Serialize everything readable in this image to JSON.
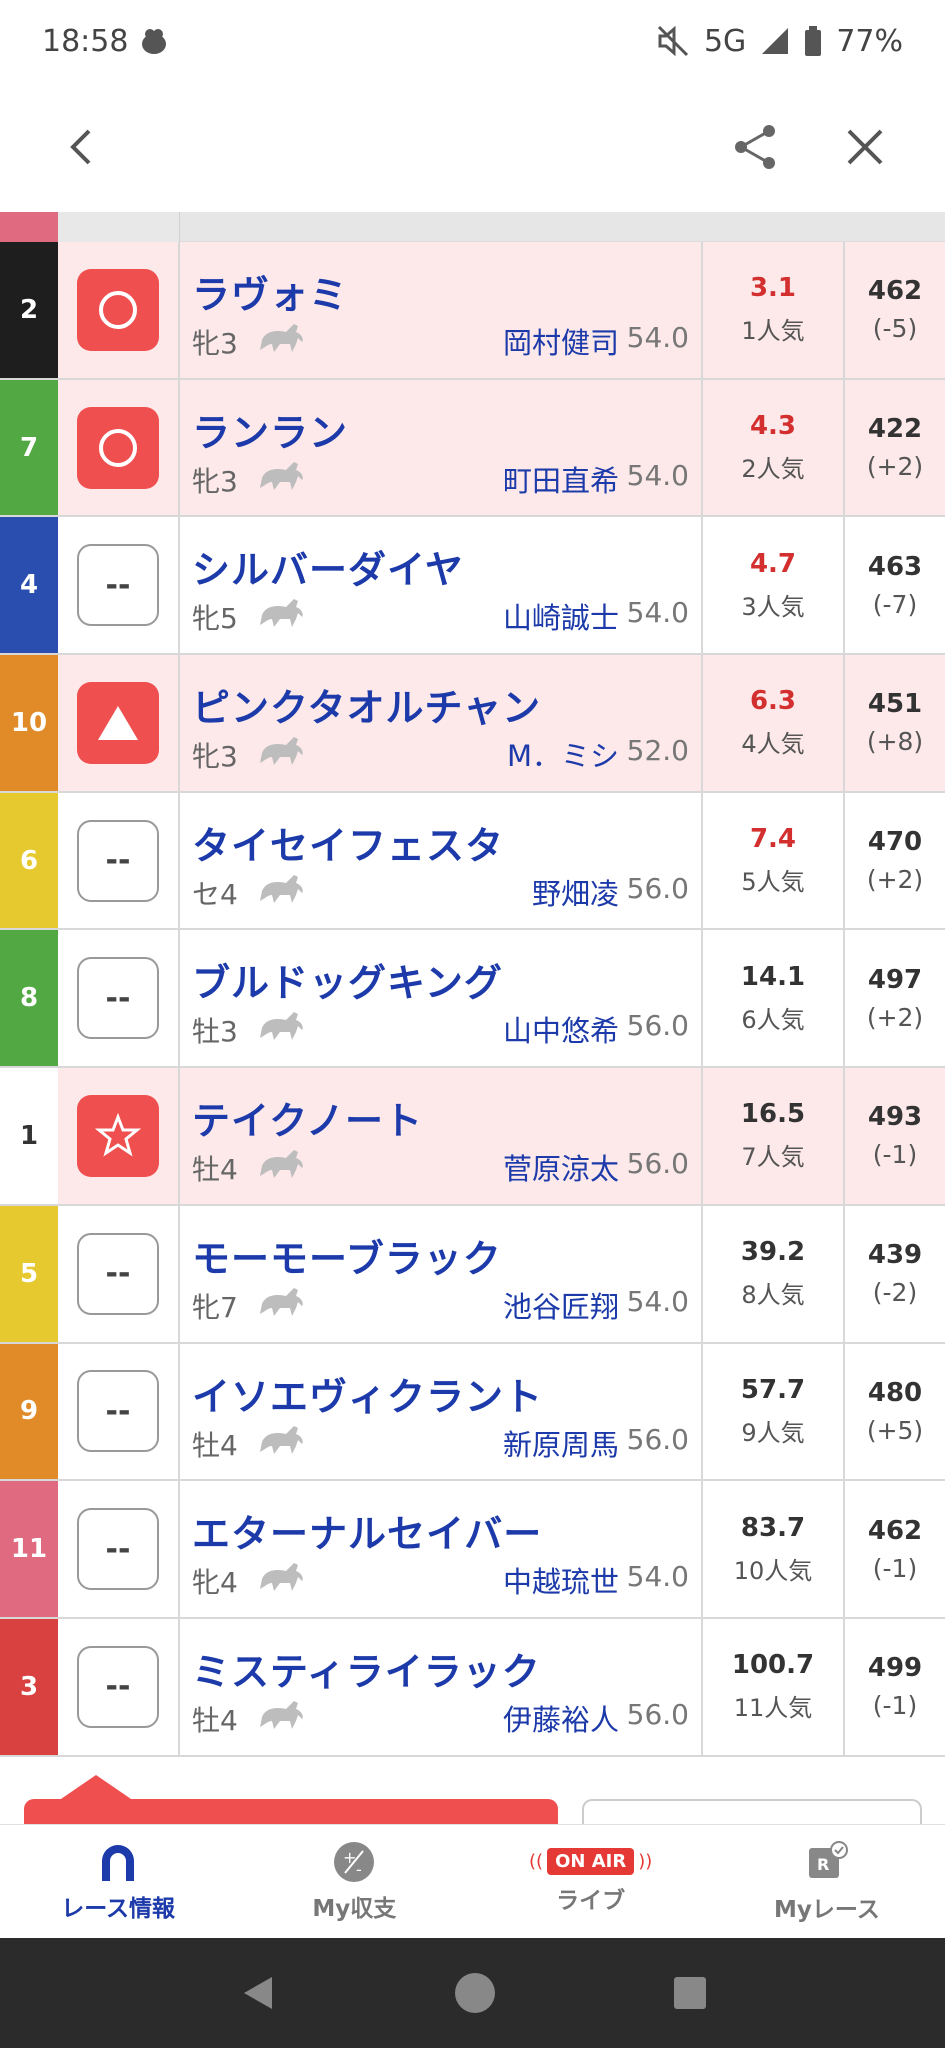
{
  "status_bar": {
    "time": "18:58",
    "network": "5G",
    "battery": "77%"
  },
  "colors": {
    "accent_red": "#ef4f4f",
    "name_blue": "#1c3aa9",
    "pink_row": "#fde9ea",
    "odds_red": "#d32f2f"
  },
  "rows": [
    {
      "waku": "2",
      "waku_color": "#1e1e1e",
      "waku_text": "#ffffff",
      "pink": true,
      "mark": "circle-icon",
      "name": "ラヴォミ",
      "sex_age": "牝3",
      "jockey": "岡村健司",
      "kinryo": "54.0",
      "odds": "3.1",
      "ninki": "1人気",
      "odds_hot": true,
      "weight": "462",
      "diff": "(-5)"
    },
    {
      "waku": "7",
      "waku_color": "#52a943",
      "waku_text": "#ffffff",
      "pink": true,
      "mark": "circle-icon",
      "name": "ランラン",
      "sex_age": "牝3",
      "jockey": "町田直希",
      "kinryo": "54.0",
      "odds": "4.3",
      "ninki": "2人気",
      "odds_hot": true,
      "weight": "422",
      "diff": "(+2)"
    },
    {
      "waku": "4",
      "waku_color": "#2a4eb0",
      "waku_text": "#ffffff",
      "pink": false,
      "mark": "--",
      "name": "シルバーダイヤ",
      "sex_age": "牝5",
      "jockey": "山崎誠士",
      "kinryo": "54.0",
      "odds": "4.7",
      "ninki": "3人気",
      "odds_hot": true,
      "weight": "463",
      "diff": "(-7)"
    },
    {
      "waku": "10",
      "waku_color": "#e08a28",
      "waku_text": "#ffffff",
      "pink": true,
      "mark": "triangle-icon",
      "name": "ピンクタオルチャン",
      "sex_age": "牝3",
      "jockey": "М．ミシ",
      "kinryo": "52.0",
      "odds": "6.3",
      "ninki": "4人気",
      "odds_hot": true,
      "weight": "451",
      "diff": "(+8)"
    },
    {
      "waku": "6",
      "waku_color": "#e6c92e",
      "waku_text": "#ffffff",
      "pink": false,
      "mark": "--",
      "name": "タイセイフェスタ",
      "sex_age": "セ4",
      "jockey": "野畑凌",
      "kinryo": "56.0",
      "odds": "7.4",
      "ninki": "5人気",
      "odds_hot": true,
      "weight": "470",
      "diff": "(+2)"
    },
    {
      "waku": "8",
      "waku_color": "#52a943",
      "waku_text": "#ffffff",
      "pink": false,
      "mark": "--",
      "name": "ブルドッグキング",
      "sex_age": "牡3",
      "jockey": "山中悠希",
      "kinryo": "56.0",
      "odds": "14.1",
      "ninki": "6人気",
      "odds_hot": false,
      "weight": "497",
      "diff": "(+2)"
    },
    {
      "waku": "1",
      "waku_color": "#ffffff",
      "waku_text": "#333333",
      "pink": true,
      "mark": "star-icon",
      "name": "テイクノート",
      "sex_age": "牡4",
      "jockey": "菅原涼太",
      "kinryo": "56.0",
      "odds": "16.5",
      "ninki": "7人気",
      "odds_hot": false,
      "weight": "493",
      "diff": "(-1)"
    },
    {
      "waku": "5",
      "waku_color": "#e6c92e",
      "waku_text": "#ffffff",
      "pink": false,
      "mark": "--",
      "name": "モーモーブラック",
      "sex_age": "牝7",
      "jockey": "池谷匠翔",
      "kinryo": "54.0",
      "odds": "39.2",
      "ninki": "8人気",
      "odds_hot": false,
      "weight": "439",
      "diff": "(-2)"
    },
    {
      "waku": "9",
      "waku_color": "#e08a28",
      "waku_text": "#ffffff",
      "pink": false,
      "mark": "--",
      "name": "イソエヴィクラント",
      "sex_age": "牡4",
      "jockey": "新原周馬",
      "kinryo": "56.0",
      "odds": "57.7",
      "ninki": "9人気",
      "odds_hot": false,
      "weight": "480",
      "diff": "(+5)"
    },
    {
      "waku": "11",
      "waku_color": "#e06a80",
      "waku_text": "#ffffff",
      "pink": false,
      "mark": "--",
      "name": "エターナルセイバー",
      "sex_age": "牝4",
      "jockey": "中越琉世",
      "kinryo": "54.0",
      "odds": "83.7",
      "ninki": "10人気",
      "odds_hot": false,
      "weight": "462",
      "diff": "(-1)"
    },
    {
      "waku": "3",
      "waku_color": "#d94040",
      "waku_text": "#ffffff",
      "pink": false,
      "mark": "--",
      "name": "ミスティライラック",
      "sex_age": "牡4",
      "jockey": "伊藤裕人",
      "kinryo": "56.0",
      "odds": "100.7",
      "ninki": "11人気",
      "odds_hot": false,
      "weight": "499",
      "diff": "(-1)"
    }
  ],
  "bottom_nav": {
    "items": [
      {
        "label": "レース情報",
        "icon": "horseshoe-icon",
        "active": true
      },
      {
        "label": "My収支",
        "icon": "plus-minus-icon",
        "active": false
      },
      {
        "label": "ライブ",
        "icon": "on-air-icon",
        "badge": "ON AIR",
        "active": false
      },
      {
        "label": "Myレース",
        "icon": "my-race-icon",
        "active": false
      }
    ]
  }
}
